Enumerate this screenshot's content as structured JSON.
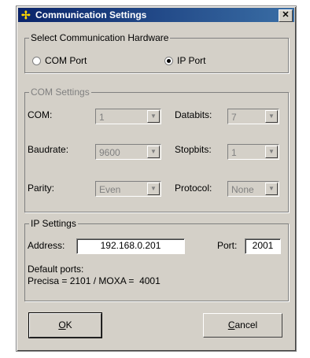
{
  "window": {
    "title": "Communication Settings",
    "close_glyph": "✕"
  },
  "hardware_group": {
    "legend": "Select Communication Hardware",
    "options": [
      {
        "label": "COM Port",
        "selected": false
      },
      {
        "label": "IP Port",
        "selected": true
      }
    ]
  },
  "com_group": {
    "legend": "COM Settings",
    "com_label": "COM:",
    "com_value": "1",
    "databits_label": "Databits:",
    "databits_value": "7",
    "baudrate_label": "Baudrate:",
    "baudrate_value": "9600",
    "stopbits_label": "Stopbits:",
    "stopbits_value": "1",
    "parity_label": "Parity:",
    "parity_value": "Even",
    "protocol_label": "Protocol:",
    "protocol_value": "None"
  },
  "ip_group": {
    "legend": "IP Settings",
    "address_label": "Address:",
    "address_value": "192.168.0.201",
    "port_label": "Port:",
    "port_value": "2001",
    "default_ports_line1": "Default ports:",
    "default_ports_line2": "Precisa = 2101 / MOXA =  4001"
  },
  "buttons": {
    "ok_mnemonic": "O",
    "ok_rest": "K",
    "cancel_mnemonic": "C",
    "cancel_rest": "ancel"
  }
}
